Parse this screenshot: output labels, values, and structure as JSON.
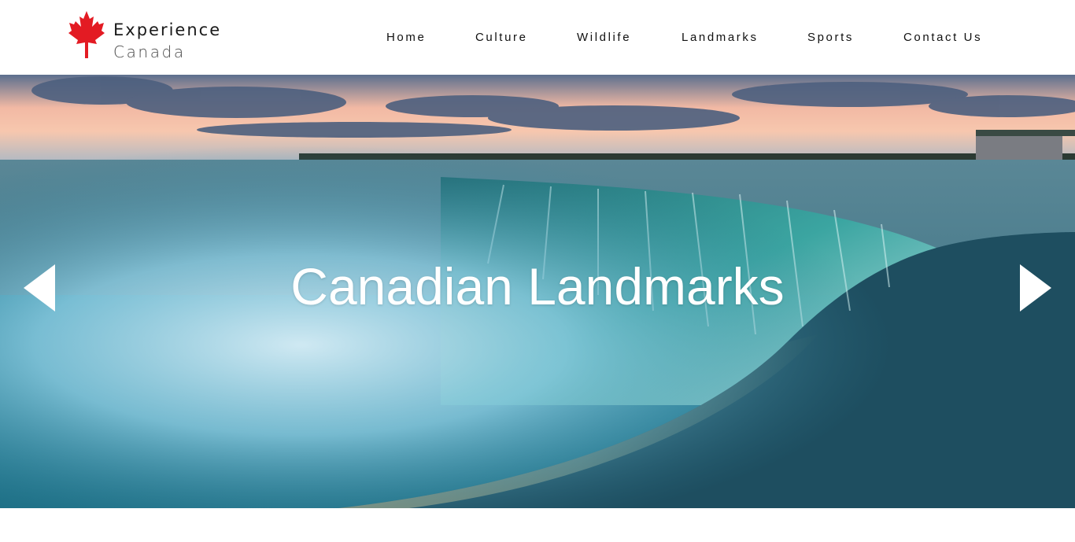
{
  "brand": {
    "line1": "Experience",
    "line2": "Canada",
    "leaf_color": "#e31b23"
  },
  "nav": {
    "items": [
      {
        "label": "Home"
      },
      {
        "label": "Culture"
      },
      {
        "label": "Wildlife"
      },
      {
        "label": "Landmarks"
      },
      {
        "label": "Sports"
      },
      {
        "label": "Contact Us"
      }
    ]
  },
  "hero": {
    "title": "Canadian Landmarks",
    "prev_icon": "triangle-left-icon",
    "next_icon": "triangle-right-icon",
    "image_subject": "waterfall-at-sunset"
  },
  "colors": {
    "header_bg": "#ffffff",
    "nav_text": "#111111",
    "hero_text": "#ffffff",
    "water_teal": "#2a7f95"
  }
}
